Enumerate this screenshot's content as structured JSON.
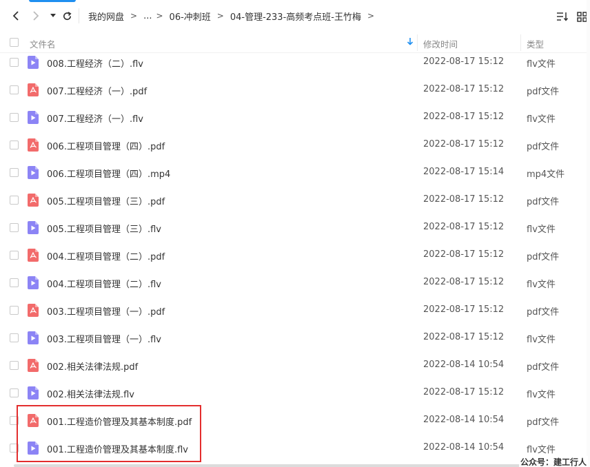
{
  "toolbar": {
    "back_icon": "chevron-left-icon",
    "forward_icon": "chevron-right-icon",
    "history_dropdown_icon": "caret-down-icon",
    "refresh_icon": "refresh-icon",
    "sort_icon": "sort-list-icon",
    "view_icon": "grid-view-icon"
  },
  "breadcrumb": {
    "items": [
      "我的网盘",
      "...",
      "06-冲刺班",
      "04-管理-233-高频考点班-王竹梅"
    ],
    "separator": ">"
  },
  "header": {
    "name": "文件名",
    "sort_arrow": "↓",
    "modified": "修改时间",
    "type": "类型"
  },
  "files": [
    {
      "name": "008.工程经济（二）.flv",
      "time": "2022-08-17 15:12",
      "type": "flv文件",
      "kind": "video"
    },
    {
      "name": "007.工程经济（一）.pdf",
      "time": "2022-08-17 15:12",
      "type": "pdf文件",
      "kind": "pdf"
    },
    {
      "name": "007.工程经济（一）.flv",
      "time": "2022-08-17 15:12",
      "type": "flv文件",
      "kind": "video"
    },
    {
      "name": "006.工程项目管理（四）.pdf",
      "time": "2022-08-17 15:12",
      "type": "pdf文件",
      "kind": "pdf"
    },
    {
      "name": "006.工程项目管理（四）.mp4",
      "time": "2022-08-17 15:14",
      "type": "mp4文件",
      "kind": "video"
    },
    {
      "name": "005.工程项目管理（三）.pdf",
      "time": "2022-08-17 15:12",
      "type": "pdf文件",
      "kind": "pdf"
    },
    {
      "name": "005.工程项目管理（三）.flv",
      "time": "2022-08-17 15:12",
      "type": "flv文件",
      "kind": "video"
    },
    {
      "name": "004.工程项目管理（二）.pdf",
      "time": "2022-08-17 15:12",
      "type": "pdf文件",
      "kind": "pdf"
    },
    {
      "name": "004.工程项目管理（二）.flv",
      "time": "2022-08-17 15:12",
      "type": "flv文件",
      "kind": "video"
    },
    {
      "name": "003.工程项目管理（一）.pdf",
      "time": "2022-08-17 15:12",
      "type": "pdf文件",
      "kind": "pdf"
    },
    {
      "name": "003.工程项目管理（一）.flv",
      "time": "2022-08-17 15:12",
      "type": "flv文件",
      "kind": "video"
    },
    {
      "name": "002.相关法律法规.pdf",
      "time": "2022-08-14 10:54",
      "type": "pdf文件",
      "kind": "pdf"
    },
    {
      "name": "002.相关法律法规.flv",
      "time": "2022-08-17 15:12",
      "type": "flv文件",
      "kind": "video"
    },
    {
      "name": "001.工程造价管理及其基本制度.pdf",
      "time": "2022-08-14 10:54",
      "type": "pdf文件",
      "kind": "pdf"
    },
    {
      "name": "001.工程造价管理及其基本制度.flv",
      "time": "2022-08-14 10:54",
      "type": "flv文件",
      "kind": "video"
    }
  ],
  "watermark": "公众号：建工行人",
  "colors": {
    "pdf_icon": "#f26b6b",
    "video_icon": "#8c84f5",
    "highlight_box": "#e32d2d",
    "accent": "#1f8ff0"
  }
}
